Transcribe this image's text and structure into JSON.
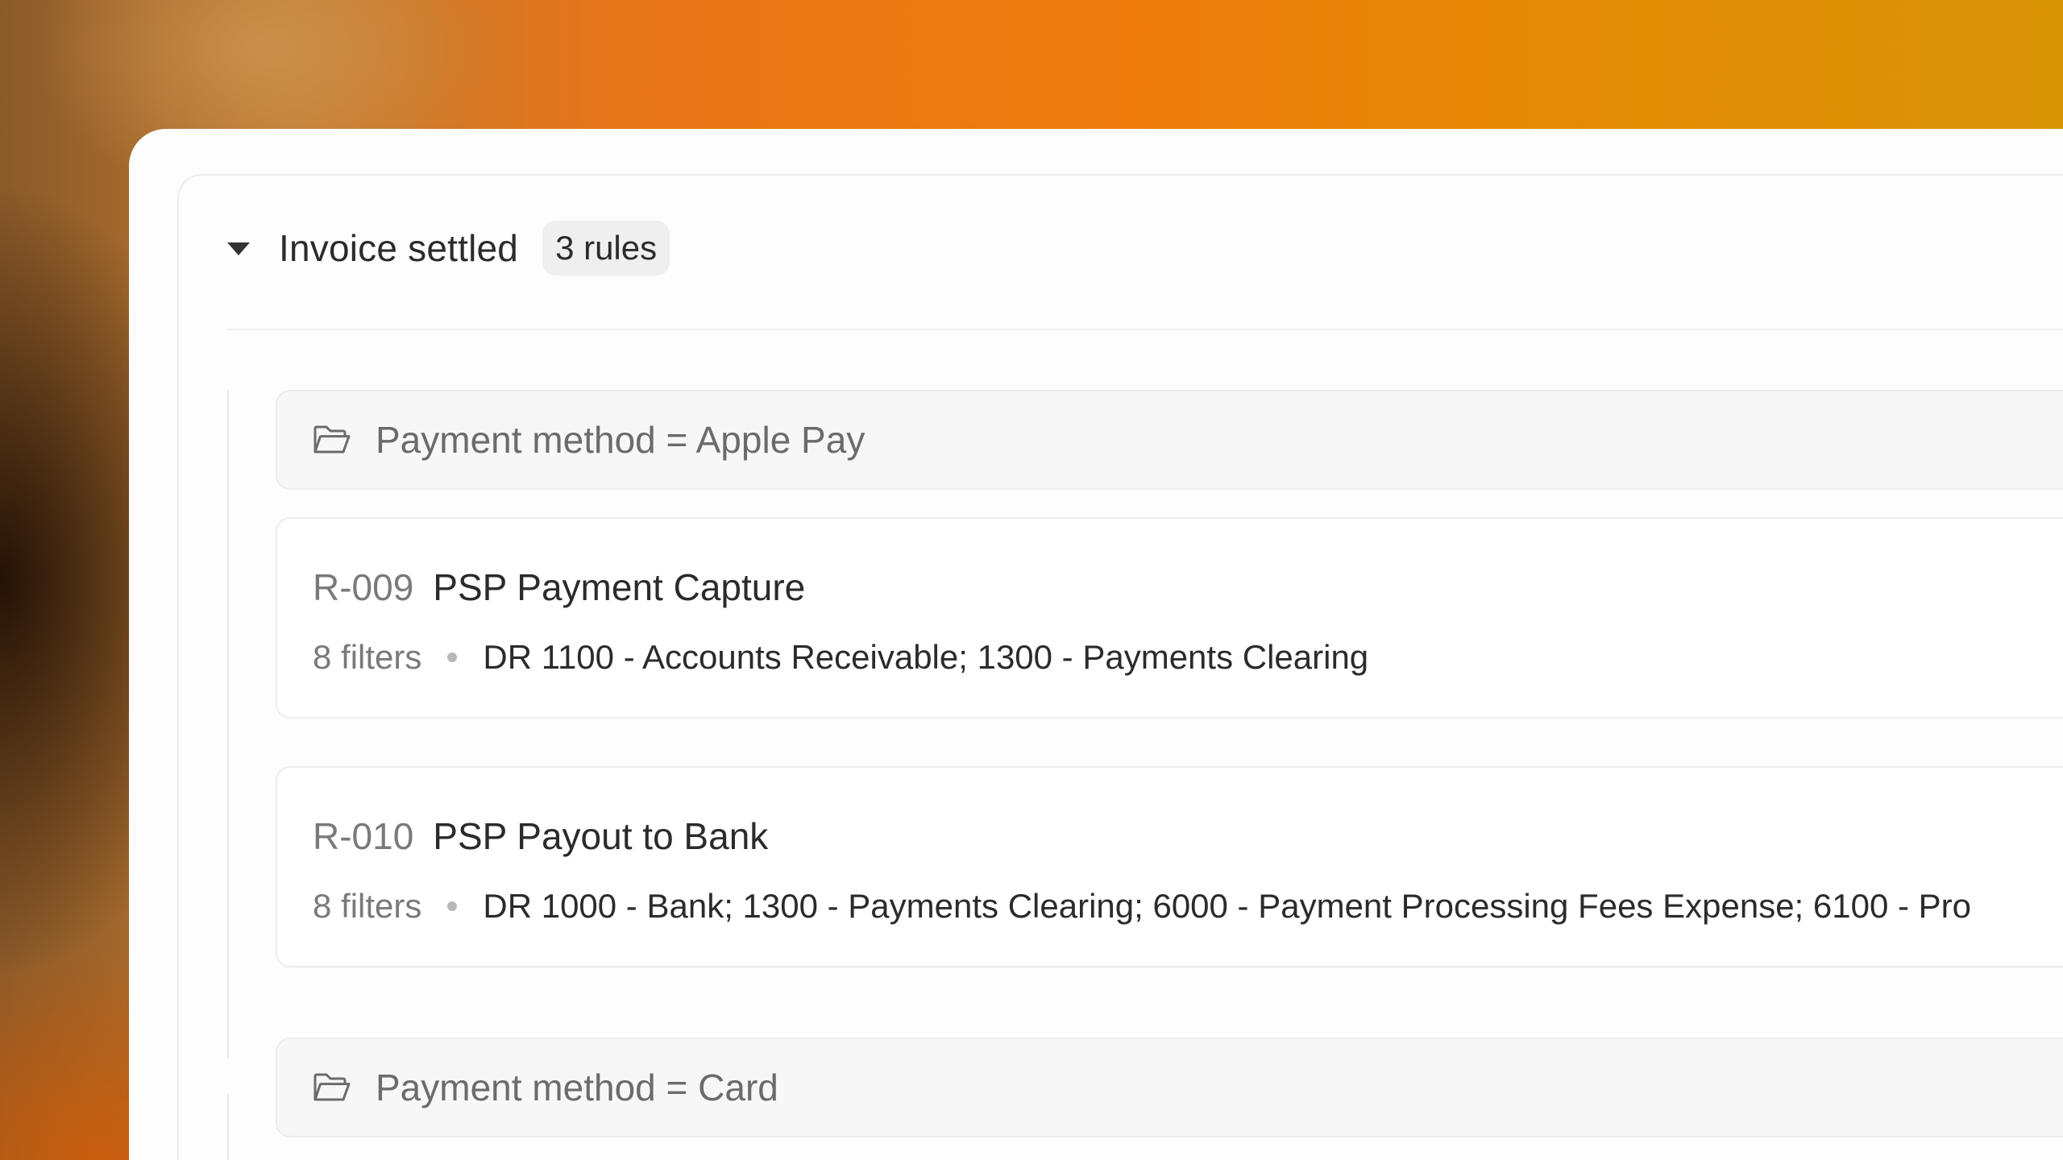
{
  "group": {
    "title": "Invoice settled",
    "badge": "3 rules"
  },
  "folders": [
    {
      "label": "Payment method = Apple Pay",
      "icon": "folder-open-icon"
    },
    {
      "label": "Payment method = Card",
      "icon": "folder-open-icon"
    }
  ],
  "rules": [
    {
      "id": "R-009",
      "name": "PSP Payment Capture",
      "filters": "8 filters",
      "description": "DR 1100 - Accounts Receivable; 1300 - Payments Clearing"
    },
    {
      "id": "R-010",
      "name": "PSP Payout to Bank",
      "filters": "8 filters",
      "description": "DR 1000 - Bank; 1300 - Payments Clearing; 6000 - Payment Processing Fees Expense; 6100 - Pro"
    }
  ],
  "colors": {
    "panel_bg": "#fdfdfd",
    "folder_bg": "#f7f7f7",
    "text_primary": "#2b2b2b",
    "text_secondary": "#7a7a7a"
  }
}
